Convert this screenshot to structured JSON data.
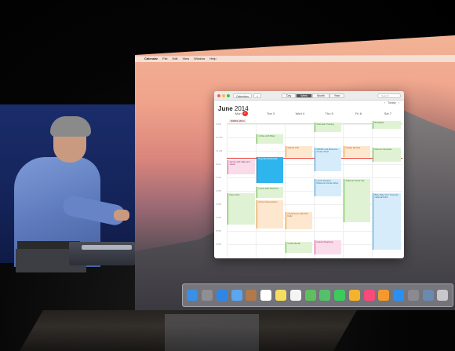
{
  "menubar": {
    "items": [
      "Calendar",
      "File",
      "Edit",
      "View",
      "Window",
      "Help"
    ]
  },
  "calendar": {
    "toolbar": {
      "calendars_label": "Calendars",
      "add_label": "+",
      "view_tabs": [
        "Day",
        "Week",
        "Month",
        "Year"
      ],
      "active_view": "Week",
      "search_placeholder": "Search"
    },
    "month_title_bold": "June",
    "month_title_year": "2014",
    "nav": {
      "prev": "‹",
      "today": "Today",
      "next": "›"
    },
    "days": [
      {
        "label": "Mon",
        "today_num": "2"
      },
      {
        "label": "Tue 3",
        "today_num": ""
      },
      {
        "label": "Wed 4",
        "today_num": ""
      },
      {
        "label": "Thu 5",
        "today_num": ""
      },
      {
        "label": "Fri 6",
        "today_num": ""
      },
      {
        "label": "Sat 7",
        "today_num": ""
      }
    ],
    "allday_event": "WWDC 2014",
    "hours": [
      "9 AM",
      "10 AM",
      "11 AM",
      "Noon",
      "1 PM",
      "2 PM",
      "3 PM",
      "4 PM",
      "5 PM",
      "6 PM"
    ],
    "events": [
      {
        "title": "Breakfast",
        "color": "green"
      },
      {
        "title": "Mountain Training",
        "color": "green"
      },
      {
        "title": "Coffee with Brian",
        "color": "green"
      },
      {
        "title": "Mauna Chil",
        "color": "orange"
      },
      {
        "title": "Design Review",
        "color": "orange"
      },
      {
        "title": "Meet at Campsite",
        "color": "green"
      },
      {
        "title": "Tennis with Sally and Jason",
        "color": "pink"
      },
      {
        "title": "Keynote Rehearsal",
        "color": "selected"
      },
      {
        "title": "WWDC Lab Moscone Center West",
        "color": "blue"
      },
      {
        "title": "Lunch with Mossimo",
        "color": "green"
      },
      {
        "title": "Lunch Session Moscone Center West",
        "color": "blue"
      },
      {
        "title": "Sabrina's Field Trip",
        "color": "green"
      },
      {
        "title": "Meet John",
        "color": "green"
      },
      {
        "title": "Dinner Reservation",
        "color": "orange"
      },
      {
        "title": "Conference Call with Kelly",
        "color": "orange"
      },
      {
        "title": "Bike Ride Tour Yosemite National Park",
        "color": "blue"
      },
      {
        "title": "Coffee Break",
        "color": "green"
      },
      {
        "title": "Family Shopping",
        "color": "pink"
      }
    ]
  },
  "dock": {
    "icons": [
      "finder-icon",
      "launchpad-icon",
      "safari-icon",
      "mail-icon",
      "contacts-icon",
      "calendar-icon",
      "notes-icon",
      "reminders-icon",
      "maps-icon",
      "messages-icon",
      "facetime-icon",
      "photos-icon",
      "itunes-icon",
      "ibooks-icon",
      "app-store-icon",
      "system-preferences-icon",
      "downloads-icon",
      "trash-icon"
    ],
    "colors": [
      "#3a8fe6",
      "#8e8e93",
      "#2e87e6",
      "#5aa7f0",
      "#b07a4a",
      "#ffffff",
      "#f5dd62",
      "#f4f4f4",
      "#5fbf5f",
      "#55c06b",
      "#3ec95c",
      "#f4b32d",
      "#fa4a7a",
      "#f49a2d",
      "#2b8ff0",
      "#8a8a90",
      "#6a8aaf",
      "#c8c8cc"
    ]
  }
}
